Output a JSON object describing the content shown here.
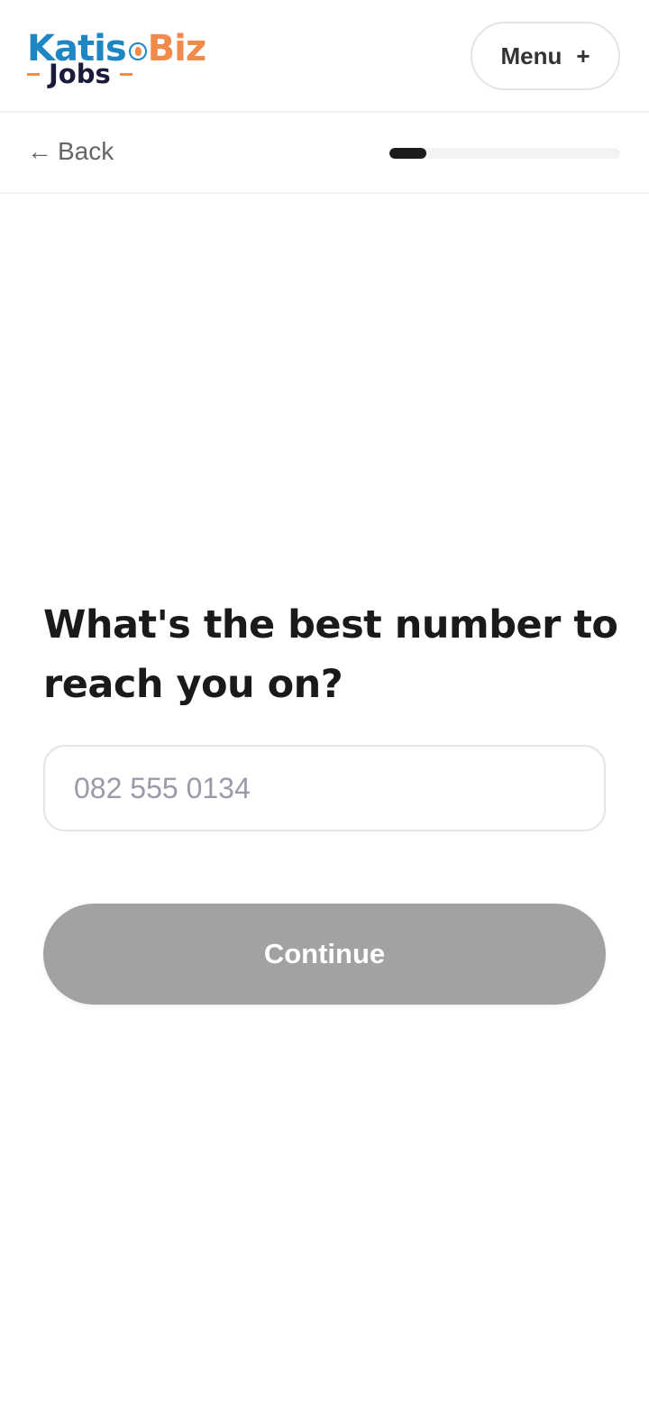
{
  "brand": {
    "name_part1": "Katis",
    "name_part2": "Biz",
    "subname": "Jobs",
    "colors": {
      "blue": "#1f86c4",
      "orange": "#f28a4b",
      "navy": "#1a1a3a"
    }
  },
  "header": {
    "menu_label": "Menu",
    "menu_icon": "+"
  },
  "nav": {
    "back_arrow": "←",
    "back_label": "Back",
    "progress_fraction": 0.16
  },
  "form": {
    "question": "What's the best number to reach you on?",
    "phone_placeholder": "082 555 0134",
    "phone_value": "",
    "continue_label": "Continue",
    "continue_enabled": false,
    "continue_color": "#a2a2a2"
  }
}
